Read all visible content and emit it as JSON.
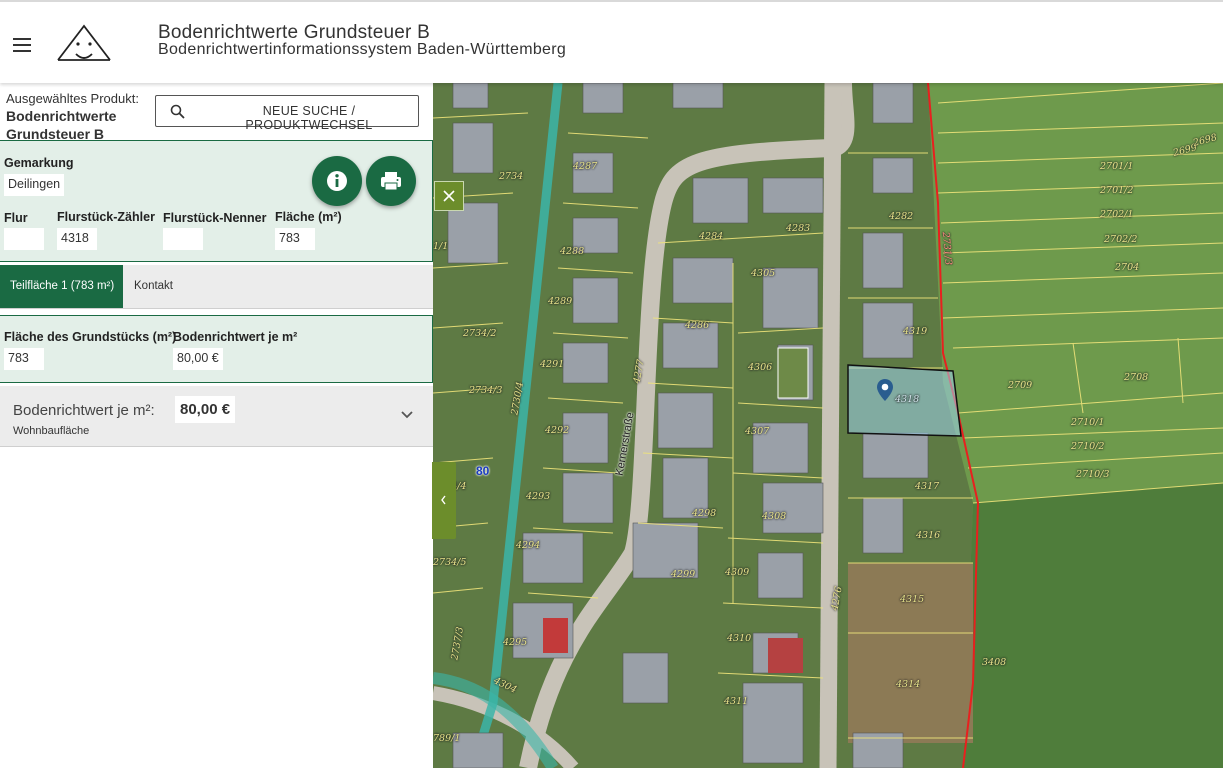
{
  "header": {
    "title": "Bodenrichtwerte Grundsteuer B",
    "subtitle": "Bodenrichtwertinformationssystem Baden-Württemberg"
  },
  "panel": {
    "product_label": "Ausgewähltes Produkt:",
    "product_name": "Bodenrichtwerte Grundsteuer B",
    "search_button": "NEUE SUCHE / PRODUKTWECHSEL",
    "gemarkung_label": "Gemarkung",
    "gemarkung_value": "Deilingen",
    "flur_label": "Flur",
    "flur_value": "",
    "zaehler_label": "Flurstück-Zähler",
    "zaehler_value": "4318",
    "nenner_label": "Flurstück-Nenner",
    "nenner_value": "",
    "flaeche_label": "Fläche (m²)",
    "flaeche_value": "783",
    "tabs": [
      {
        "label": "Teilfläche 1 (783 m²)",
        "active": true
      },
      {
        "label": "Kontakt",
        "active": false
      }
    ],
    "grundstueck_label": "Fläche des Grundstücks (m²)",
    "grundstueck_value": "783",
    "brw_label_short": "Bodenrichtwert je m²",
    "brw_value_short": "80,00 €",
    "brw_row_label": "Bodenrichtwert je m²:",
    "brw_row_sub": "Wohnbaufläche",
    "brw_row_value": "80,00 €"
  },
  "map": {
    "street_name": "Kernerstraße",
    "road_number": "80",
    "parcel_labels": [
      "4287",
      "2734",
      "4288",
      "4289",
      "2734/2",
      "4291",
      "2734/3",
      "4292",
      "4293",
      "4294",
      "2734/5",
      "4295",
      "4304",
      "2737/3",
      "789/1",
      "4277",
      "4284",
      "4283",
      "4286",
      "4305",
      "4306",
      "4307",
      "4298",
      "4308",
      "4299",
      "4309",
      "4310",
      "4311",
      "4282",
      "4319",
      "4318",
      "4317",
      "4316",
      "4315",
      "4314",
      "4276",
      "2699",
      "2698",
      "2701/1",
      "2701/2",
      "2702/1",
      "2702/2",
      "2704",
      "2709",
      "2708",
      "2710/1",
      "2710/2",
      "2710/3",
      "3408",
      "2734/4",
      "2730/4",
      "2731/3",
      "1/1"
    ]
  },
  "colors": {
    "brand_green": "#1a6a43",
    "panel_tint": "#e3efe8",
    "map_toggle": "#6c8d2b",
    "boundary_red": "#e8201f",
    "selection_fill": "#9fd3ee",
    "parcel_line": "#efe47a"
  },
  "icons": [
    "menu-icon",
    "logo-icon",
    "search-icon",
    "info-icon",
    "print-icon",
    "chevron-down-icon",
    "close-icon",
    "chevron-left-icon",
    "location-pin-icon"
  ]
}
